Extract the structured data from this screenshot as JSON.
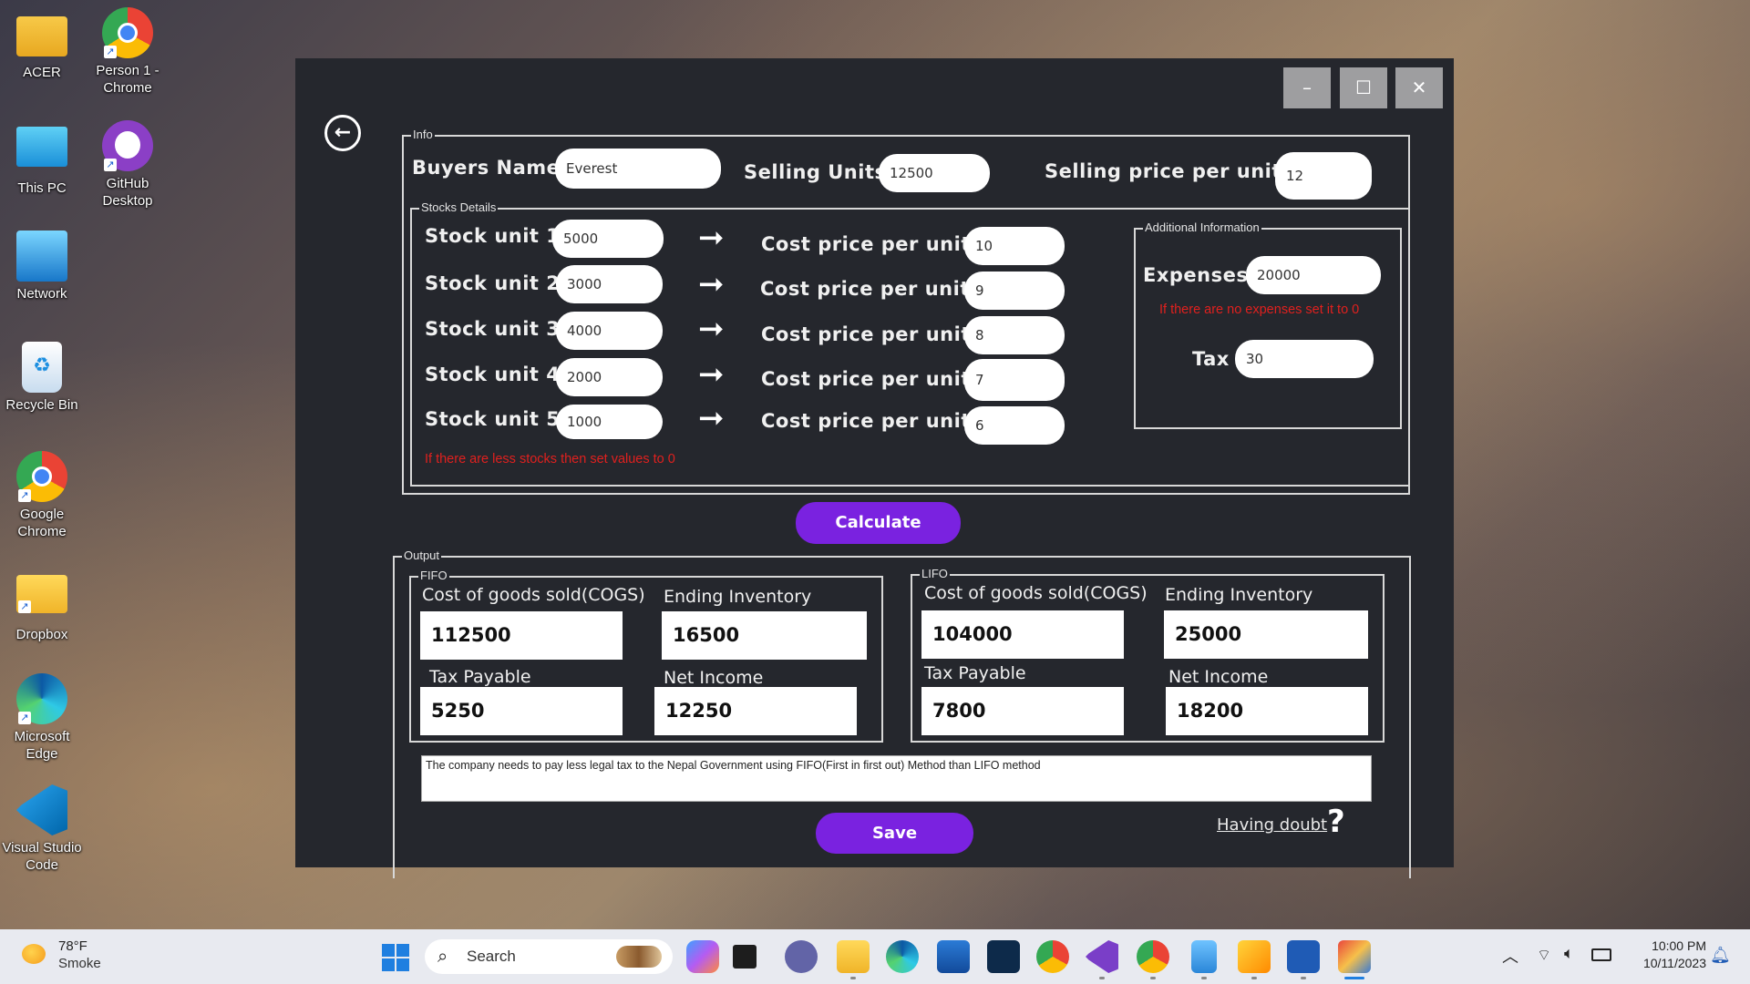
{
  "desktop": {
    "icons": [
      {
        "label": "ACER",
        "icon": "folder-icon"
      },
      {
        "label": "Person 1 - Chrome",
        "icon": "chrome-icon"
      },
      {
        "label": "This PC",
        "icon": "monitor-icon"
      },
      {
        "label": "GitHub Desktop",
        "icon": "github-icon"
      },
      {
        "label": "Network",
        "icon": "network-icon"
      },
      {
        "label": "Recycle Bin",
        "icon": "recycle-bin-icon"
      },
      {
        "label": "Google Chrome",
        "icon": "chrome-icon"
      },
      {
        "label": "Dropbox",
        "icon": "folder-icon"
      },
      {
        "label": "Microsoft Edge",
        "icon": "edge-icon"
      },
      {
        "label": "Visual Studio Code",
        "icon": "vscode-icon"
      }
    ]
  },
  "window": {
    "controls": {
      "minimize": "–",
      "maximize": "☐",
      "close": "✕"
    },
    "back": "←",
    "info": {
      "group_label": "Info",
      "buyers_name_label": "Buyers Name",
      "buyers_name_value": "Everest",
      "selling_units_label": "Selling Units",
      "selling_units_value": "12500",
      "selling_price_label": "Selling price per unit",
      "selling_price_value": "12"
    },
    "stocks": {
      "group_label": "Stocks Details",
      "rows": [
        {
          "label": "Stock unit 1",
          "units": "5000",
          "cost_label": "Cost price per unit",
          "cost": "10"
        },
        {
          "label": "Stock unit 2",
          "units": "3000",
          "cost_label": "Cost price per unit",
          "cost": "9"
        },
        {
          "label": "Stock unit 3",
          "units": "4000",
          "cost_label": "Cost price per unit",
          "cost": "8"
        },
        {
          "label": "Stock unit 4",
          "units": "2000",
          "cost_label": "Cost price per unit",
          "cost": "7"
        },
        {
          "label": "Stock unit 5",
          "units": "1000",
          "cost_label": "Cost price per unit",
          "cost": "6"
        }
      ],
      "warning": "If there are less stocks then set values to 0"
    },
    "additional": {
      "group_label": "Additional Information",
      "expenses_label": "Expenses",
      "expenses_value": "20000",
      "warning": "If there are no expenses set it to 0",
      "tax_label": "Tax",
      "tax_value": "30"
    },
    "calculate_label": "Calculate",
    "output": {
      "group_label": "Output",
      "fifo": {
        "label": "FIFO",
        "cogs_label": "Cost of goods sold(COGS)",
        "cogs": "112500",
        "ending_label": "Ending Inventory",
        "ending": "16500",
        "tax_label": "Tax Payable",
        "tax": "5250",
        "net_label": "Net Income",
        "net": "12250"
      },
      "lifo": {
        "label": "LIFO",
        "cogs_label": "Cost of goods sold(COGS)",
        "cogs": "104000",
        "ending_label": "Ending Inventory",
        "ending": "25000",
        "tax_label": "Tax Payable",
        "tax": "7800",
        "net_label": "Net Income",
        "net": "18200"
      },
      "conclusion": "The company needs to pay less legal tax to the Nepal Government using FIFO(First in first out) Method than LIFO method"
    },
    "save_label": "Save",
    "help_label": "Having doubt",
    "help_mark": "?"
  },
  "taskbar": {
    "weather_temp": "78°F",
    "weather_desc": "Smoke",
    "search_placeholder": "Search",
    "time": "10:00 PM",
    "date": "10/11/2023"
  }
}
